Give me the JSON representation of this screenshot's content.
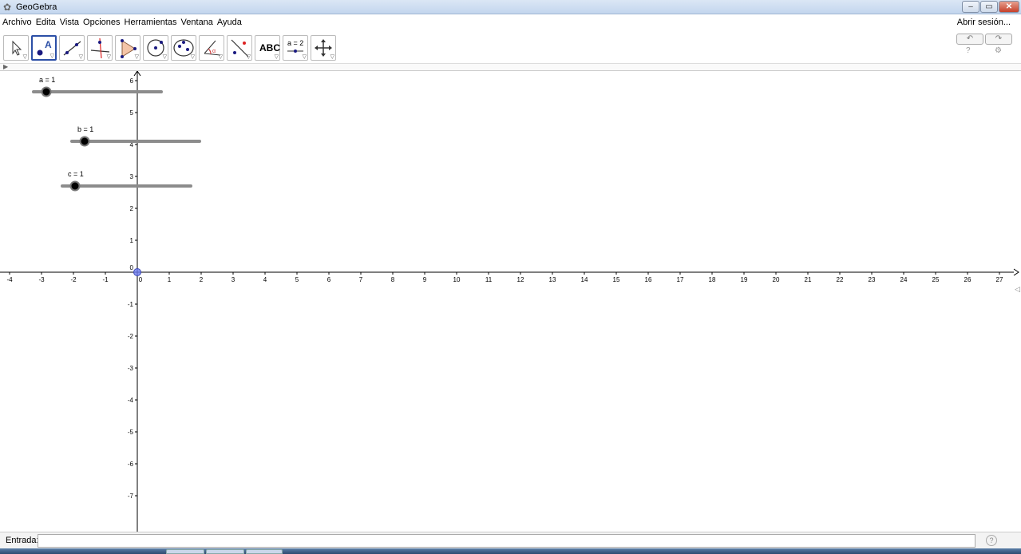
{
  "window": {
    "title": "GeoGebra",
    "minimize": "–",
    "restore": "▭",
    "close": "✕"
  },
  "menu": {
    "items": [
      "Archivo",
      "Edita",
      "Vista",
      "Opciones",
      "Herramientas",
      "Ventana",
      "Ayuda"
    ],
    "login": "Abrir sesión..."
  },
  "toolbar": {
    "tools": [
      {
        "name": "move-tool",
        "icon": "arrow-cursor-icon"
      },
      {
        "name": "point-tool",
        "icon": "point-icon",
        "selected": true
      },
      {
        "name": "line-tool",
        "icon": "line-through-points-icon"
      },
      {
        "name": "perpendicular-tool",
        "icon": "perpendicular-line-icon"
      },
      {
        "name": "polygon-tool",
        "icon": "polygon-icon"
      },
      {
        "name": "circle-tool",
        "icon": "circle-center-point-icon"
      },
      {
        "name": "ellipse-tool",
        "icon": "ellipse-icon"
      },
      {
        "name": "angle-tool",
        "icon": "angle-icon"
      },
      {
        "name": "reflect-tool",
        "icon": "reflect-icon"
      },
      {
        "name": "text-tool",
        "icon": "text-icon",
        "label": "ABC"
      },
      {
        "name": "slider-tool",
        "icon": "slider-icon",
        "label": "a = 2"
      },
      {
        "name": "move-graphics-tool",
        "icon": "move-graphics-icon"
      }
    ],
    "undo": "↶",
    "redo": "↷",
    "help": "?",
    "settings": "⚙"
  },
  "graphics": {
    "x_ticks": [
      "-4",
      "-3",
      "-2",
      "-1",
      "0",
      "1",
      "2",
      "3",
      "4",
      "5",
      "6",
      "7",
      "8",
      "9",
      "10",
      "11",
      "12",
      "13",
      "14",
      "15",
      "16",
      "17",
      "18",
      "19",
      "20",
      "21",
      "22",
      "23",
      "24",
      "25",
      "26",
      "27"
    ],
    "y_ticks": [
      "6",
      "5",
      "4",
      "3",
      "2",
      "1",
      "0",
      "-1",
      "-2",
      "-3",
      "-4",
      "-5",
      "-6",
      "-7"
    ],
    "sliders": [
      {
        "label": "a = 1",
        "value": 1
      },
      {
        "label": "b = 1",
        "value": 1
      },
      {
        "label": "c = 1",
        "value": 1
      }
    ],
    "axis_color": "#000000",
    "slider_track_color": "#8c8c8c",
    "origin_point_color": "#6d7cf0"
  },
  "input": {
    "label": "Entrada:",
    "value": "",
    "help": "?"
  }
}
